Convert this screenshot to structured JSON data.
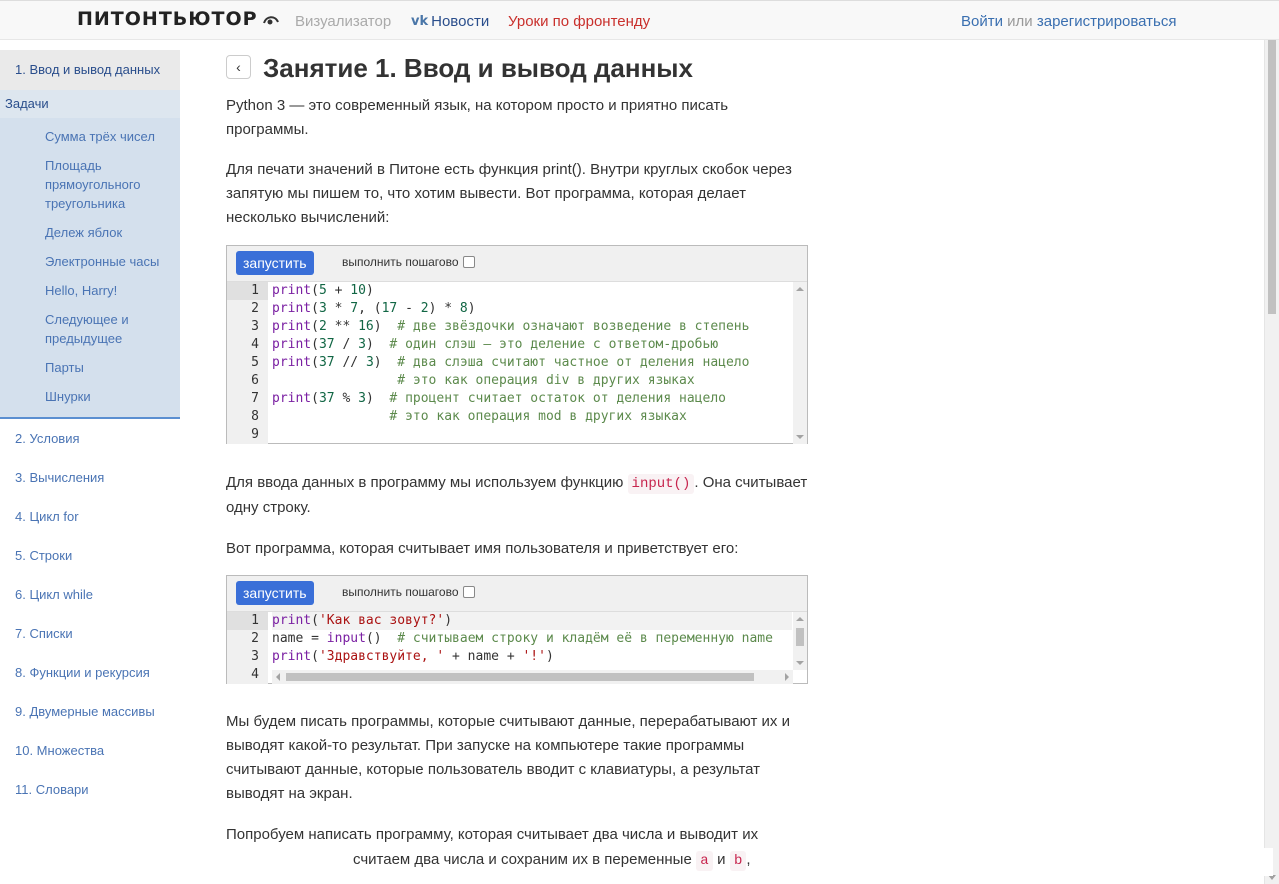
{
  "header": {
    "logo": "ПИТОНТЬЮТОР",
    "nav": {
      "visualizer": "Визуализатор",
      "vk_logo": "vk",
      "news": "Новости",
      "frontend": "Уроки по фронтенду"
    },
    "auth": {
      "login": "Войти",
      "or": "или",
      "register": "зарегистрироваться"
    }
  },
  "sidebar": {
    "active": "1. Ввод и вывод данных",
    "tasks_header": "Задачи",
    "tasks": [
      "Сумма трёх чисел",
      "Площадь прямоугольного треугольника",
      "Дележ яблок",
      "Электронные часы",
      "Hello, Harry!",
      "Следующее и предыдущее",
      "Парты",
      "Шнурки"
    ],
    "items": [
      "2. Условия",
      "3. Вычисления",
      "4. Цикл for",
      "5. Строки",
      "6. Цикл while",
      "7. Списки",
      "8. Функции и рекурсия",
      "9. Двумерные массивы",
      "10. Множества",
      "11. Словари"
    ]
  },
  "main": {
    "back": "‹",
    "title": "Занятие 1. Ввод и вывод данных",
    "p1": "Python 3 — это современный язык, на котором просто и приятно писать программы.",
    "p2": "Для печати значений в Питоне есть функция print(). Внутри круглых скобок через запятую мы пишем то, что хотим вывести. Вот программа, которая делает несколько вычислений:",
    "p3_before": "Для ввода данных в программу мы используем функцию",
    "p3_code": "input()",
    "p3_after": ". Она считывает одну строку.",
    "p4": "Вот программа, которая считывает имя пользователя и приветствует его:",
    "p5": "Мы будем писать программы, которые считывают данные, перерабатывают их и выводят какой-то результат. При запуске на компьютере такие программы считывают данные, которые пользователь вводит с клавиатуры, а результат выводят на экран.",
    "p6": "Попробуем написать программу, которая считывает два числа и выводит их",
    "p7_before": "считаем два числа и сохраним их в переменные",
    "p7_a": "a",
    "p7_and": "и",
    "p7_b": "b",
    "p7_after": ","
  },
  "editors": [
    {
      "run": "запустить",
      "step": "выполнить пошагово",
      "line_numbers": [
        "1",
        "2",
        "3",
        "4",
        "5",
        "6",
        "7",
        "8",
        "9"
      ],
      "lines": [
        "print(5 + 10)",
        "print(3 * 7, (17 - 2) * 8)",
        "print(2 ** 16)  # две звёздочки означают возведение в степень",
        "print(37 / 3)  # один слэш — это деление с ответом-дробью",
        "print(37 // 3)  # два слэша считают частное от деления нацело",
        "                # это как операция div в других языках",
        "print(37 % 3)  # процент считает остаток от деления нацело",
        "               # это как операция mod в других языках",
        ""
      ]
    },
    {
      "run": "запустить",
      "step": "выполнить пошагово",
      "line_numbers": [
        "1",
        "2",
        "3",
        "4"
      ],
      "lines": [
        "print('Как вас зовут?')",
        "name = input()  # считываем строку и кладём её в переменную name",
        "print('Здравствуйте, ' + name + '!')",
        ""
      ]
    }
  ]
}
